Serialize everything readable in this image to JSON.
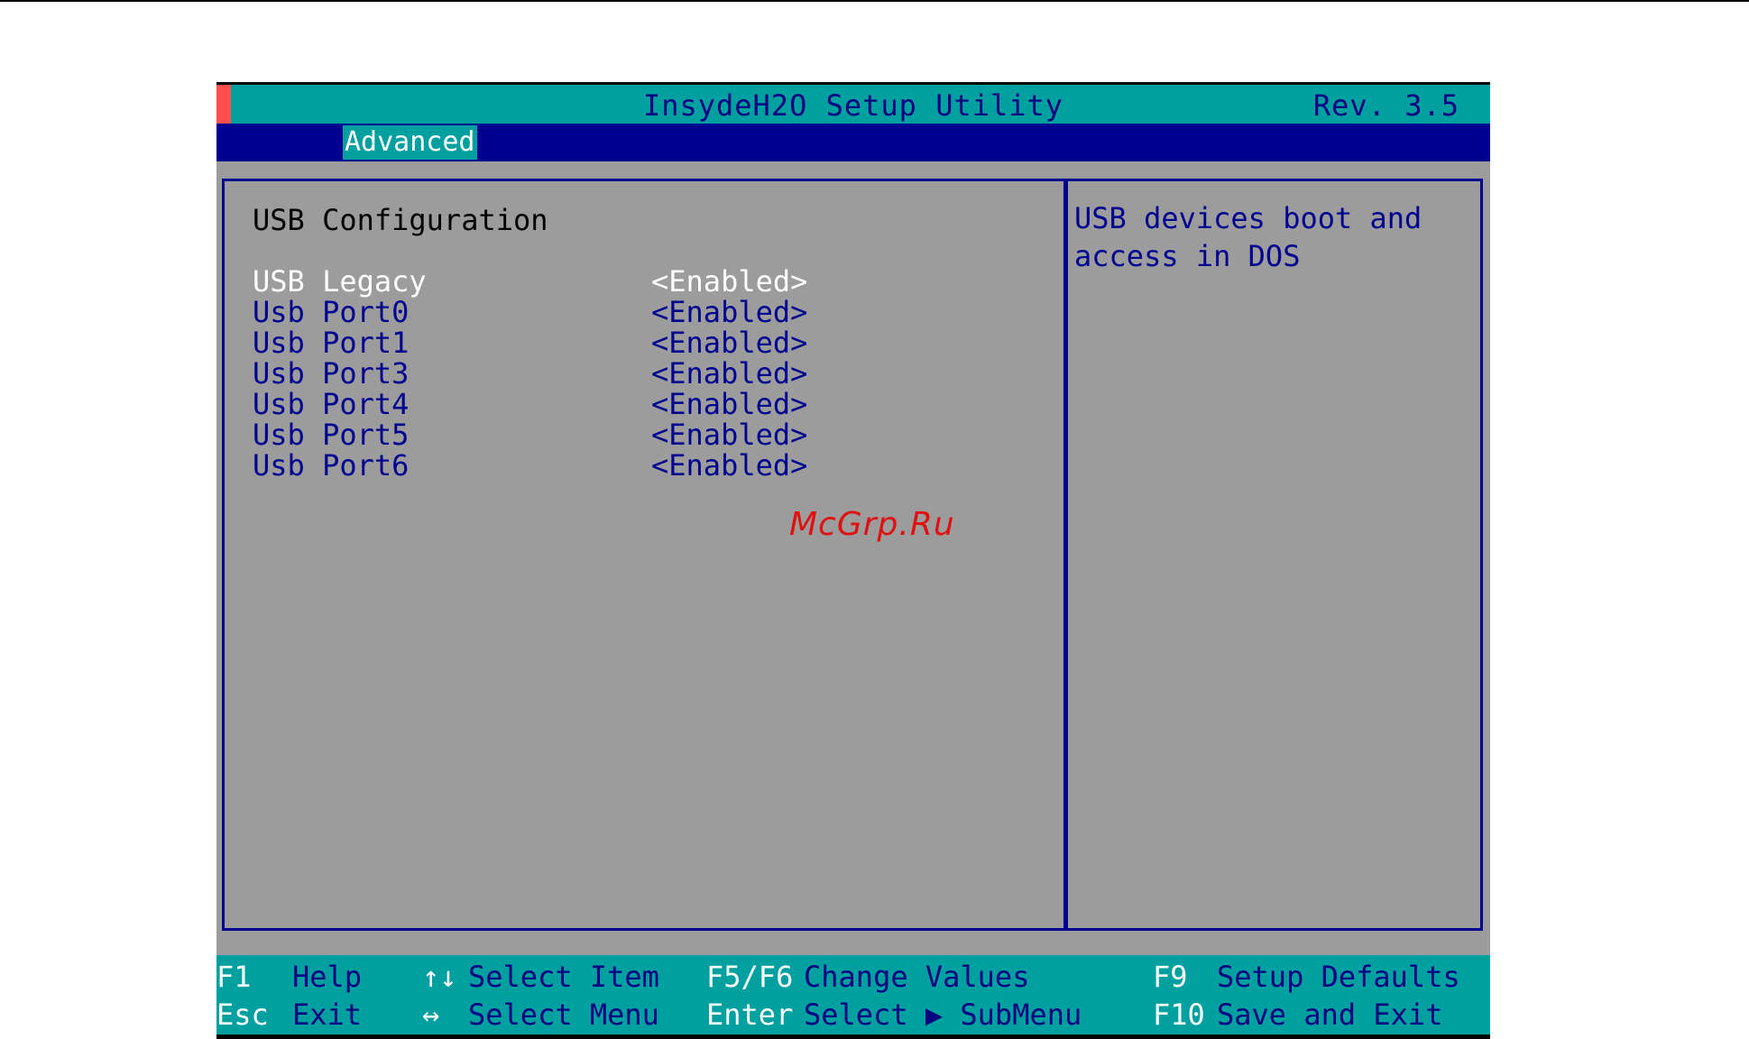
{
  "window": {
    "title": "InsydeH2O Setup Utility",
    "revision": "Rev. 3.5"
  },
  "menu": {
    "active_tab": "Advanced"
  },
  "section": {
    "title": "USB Configuration"
  },
  "settings": [
    {
      "label": "USB Legacy",
      "value": "<Enabled>",
      "selected": true
    },
    {
      "label": "Usb Port0",
      "value": "<Enabled>",
      "selected": false
    },
    {
      "label": "Usb Port1",
      "value": "<Enabled>",
      "selected": false
    },
    {
      "label": "Usb Port3",
      "value": "<Enabled>",
      "selected": false
    },
    {
      "label": "Usb Port4",
      "value": "<Enabled>",
      "selected": false
    },
    {
      "label": "Usb Port5",
      "value": "<Enabled>",
      "selected": false
    },
    {
      "label": "Usb Port6",
      "value": "<Enabled>",
      "selected": false
    }
  ],
  "help": {
    "text": "USB devices boot and\naccess in DOS"
  },
  "footer": {
    "row1": [
      {
        "key": "F1",
        "desc": "Help"
      },
      {
        "key": "↑↓",
        "desc": "Select Item"
      },
      {
        "key": "F5/F6",
        "desc": "Change Values"
      },
      {
        "key": "F9",
        "desc": "Setup Defaults"
      }
    ],
    "row2": [
      {
        "key": "Esc",
        "desc": "Exit"
      },
      {
        "key": "↔",
        "desc": "Select Menu"
      },
      {
        "key": "Enter",
        "desc": "Select ▶ SubMenu"
      },
      {
        "key": "F10",
        "desc": "Save and Exit"
      }
    ]
  },
  "watermark": "McGrp.Ru",
  "colors": {
    "background": "#9c9c9c",
    "title_bar": "#00a0a0",
    "menu_bar": "#000090",
    "text_primary": "#000090",
    "selected_text": "#ffffff",
    "accent": "#ff5050"
  }
}
